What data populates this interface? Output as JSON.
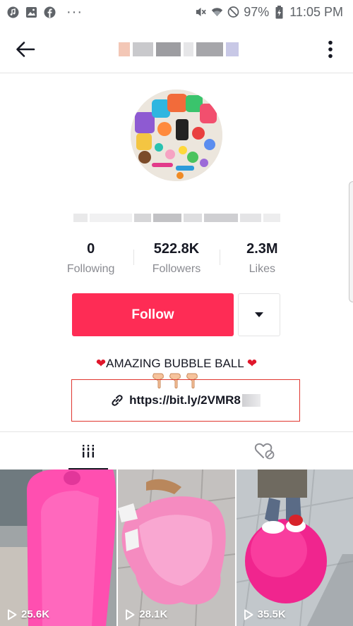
{
  "status_bar": {
    "battery": "97%",
    "time": "11:05 PM",
    "dots": "···"
  },
  "header": {
    "back_icon": "arrow-left-icon",
    "more_icon": "vertical-dots-icon"
  },
  "profile": {
    "stats": [
      {
        "value": "0",
        "label": "Following"
      },
      {
        "value": "522.8K",
        "label": "Followers"
      },
      {
        "value": "2.3M",
        "label": "Likes"
      }
    ],
    "follow_label": "Follow",
    "bio_text": "AMAZING BUBBLE BALL ",
    "link_text": "https://bit.ly/2VMR8"
  },
  "tabs": [
    {
      "name": "videos-tab",
      "icon": "grid-icon",
      "active": true
    },
    {
      "name": "liked-tab",
      "icon": "hidden-heart-icon",
      "active": false
    }
  ],
  "videos": [
    {
      "views": "25.6K"
    },
    {
      "views": "28.1K"
    },
    {
      "views": "35.5K"
    }
  ],
  "colors": {
    "accent": "#fe2c55",
    "link_border": "#e0362f"
  }
}
